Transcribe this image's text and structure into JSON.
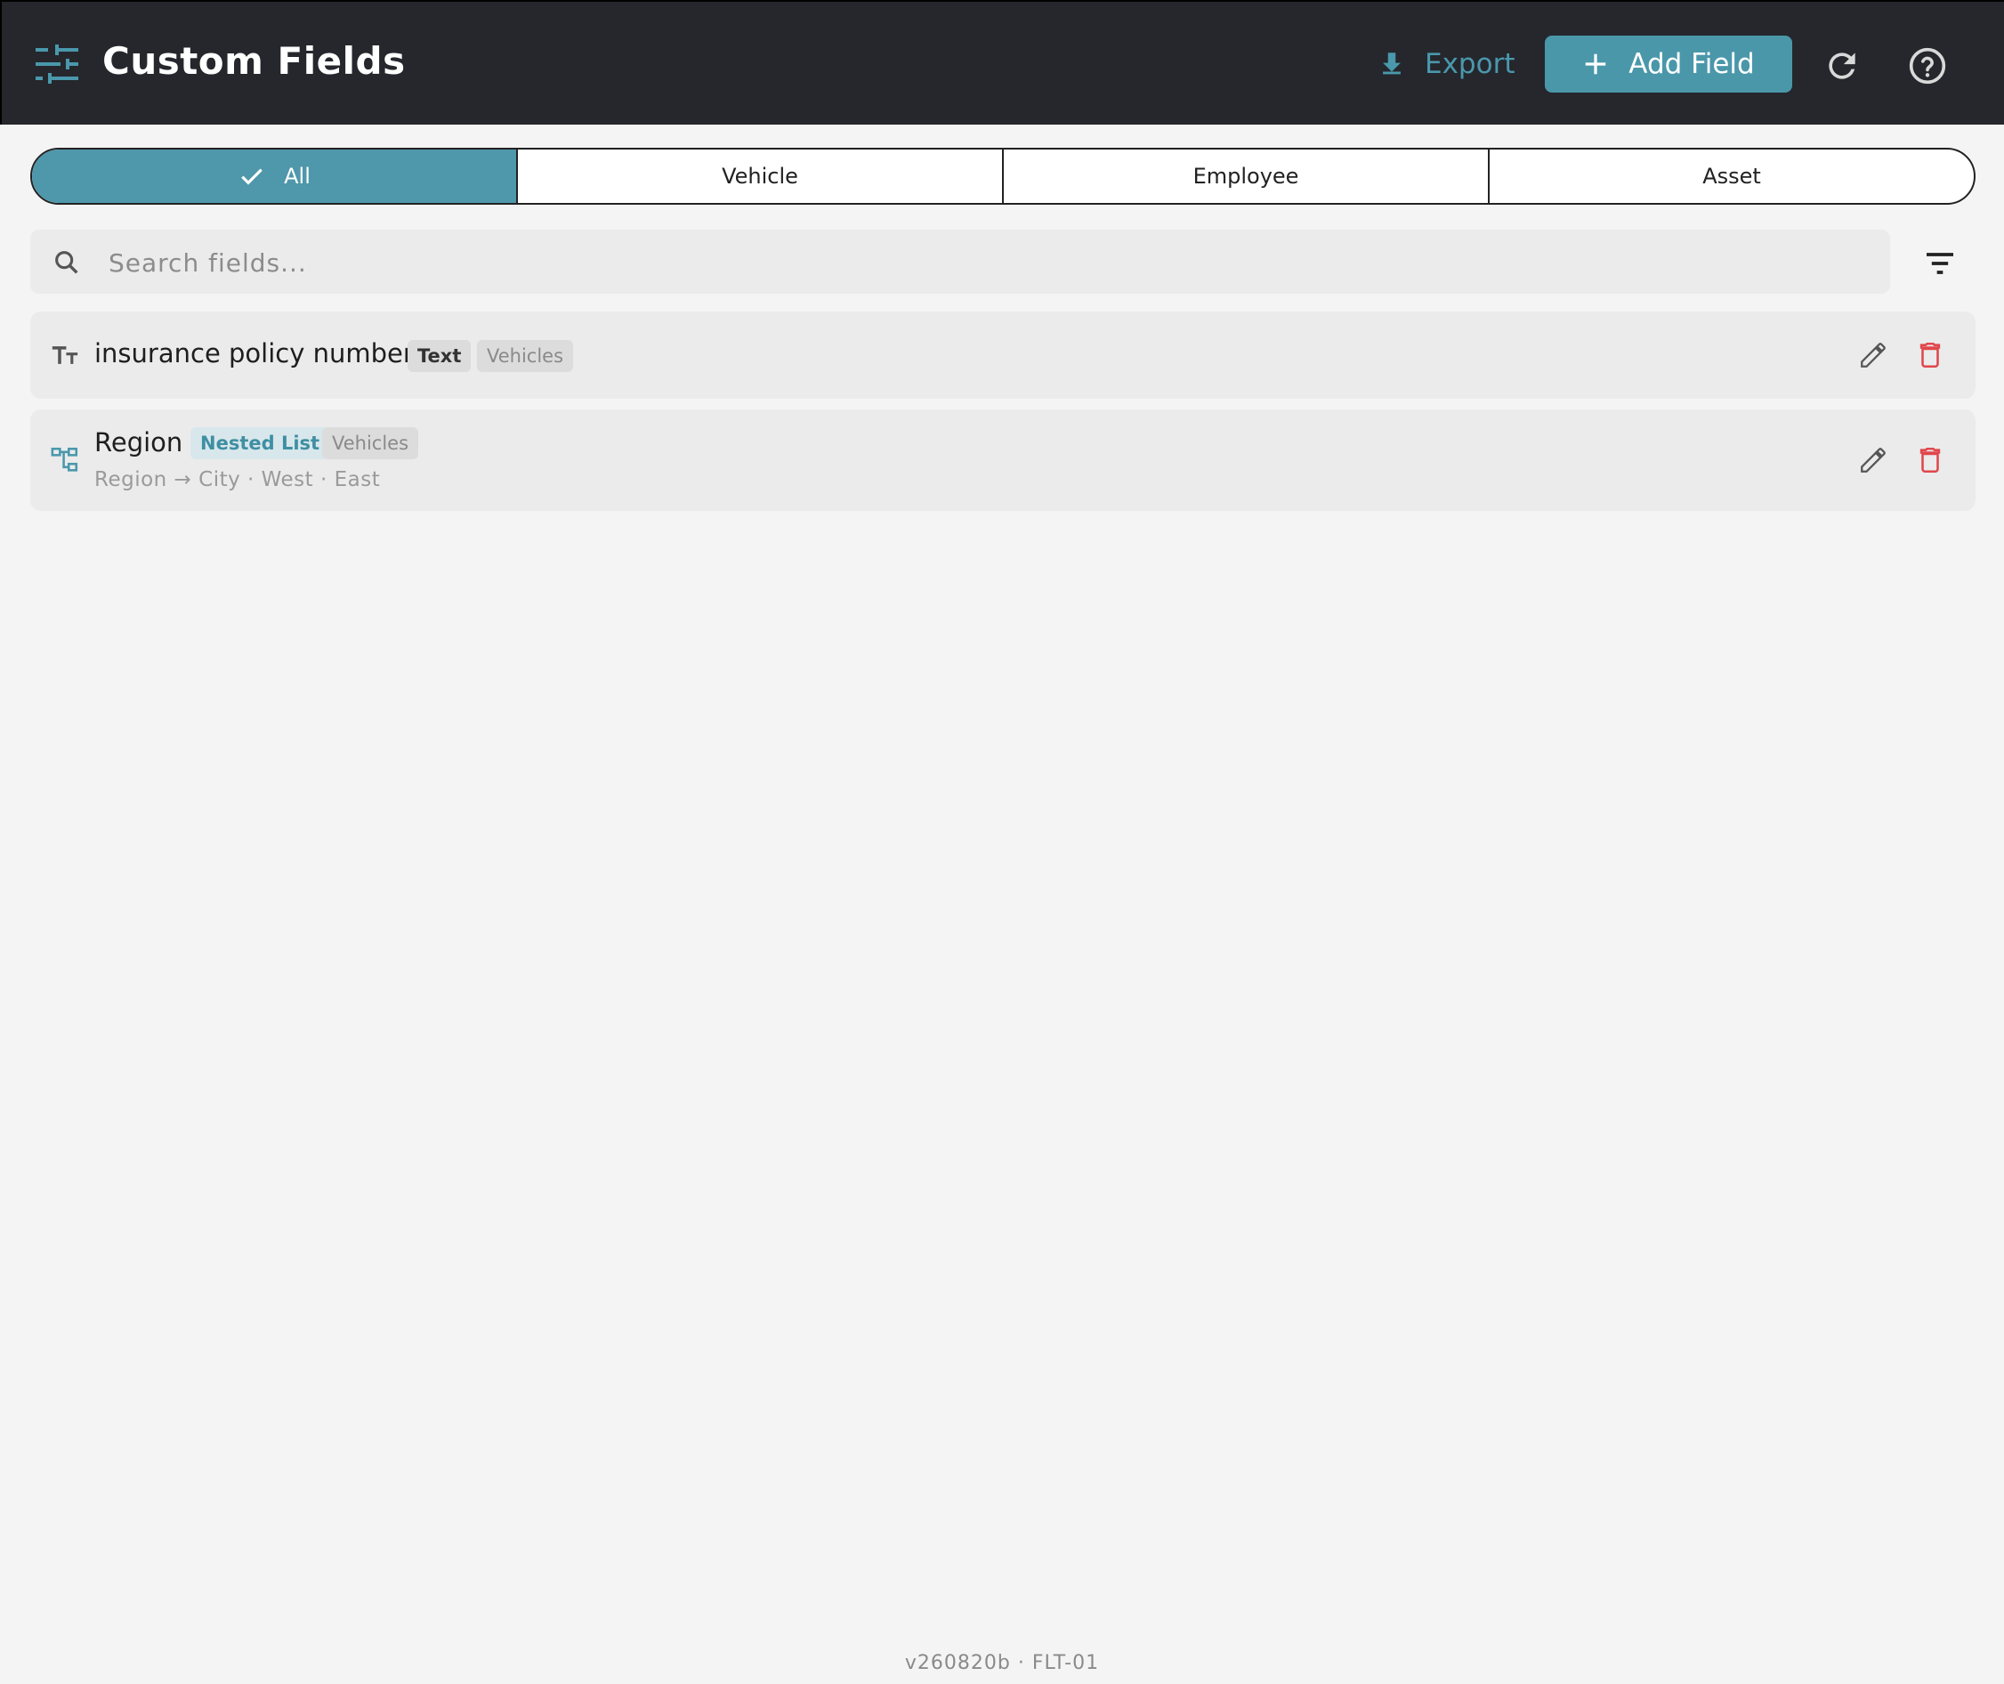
{
  "header": {
    "title": "Custom Fields",
    "export_label": "Export",
    "add_field_label": "Add Field",
    "icons": {
      "app": "tune-icon",
      "export": "download-icon",
      "add": "plus-icon",
      "refresh": "refresh-icon",
      "help": "help-circle-icon"
    }
  },
  "segments": [
    {
      "label": "All",
      "active": true
    },
    {
      "label": "Vehicle",
      "active": false
    },
    {
      "label": "Employee",
      "active": false
    },
    {
      "label": "Asset",
      "active": false
    }
  ],
  "search": {
    "placeholder": "Search fields...",
    "value": ""
  },
  "fields": [
    {
      "name": "insurance policy number",
      "type_badge": "Text",
      "scope_badge": "Vehicles",
      "icon": "text-format-icon"
    },
    {
      "name": "Region",
      "type_badge": "Nested List",
      "scope_badge": "Vehicles",
      "subtitle": "Region → City  ·  West · East",
      "icon": "hierarchy-icon"
    }
  ],
  "footer": {
    "version": "v260820b · FLT-01"
  },
  "colors": {
    "accent": "#4a97aa",
    "header_bg": "#25272d",
    "danger": "#e0474c",
    "page_bg": "#f4f4f4"
  }
}
